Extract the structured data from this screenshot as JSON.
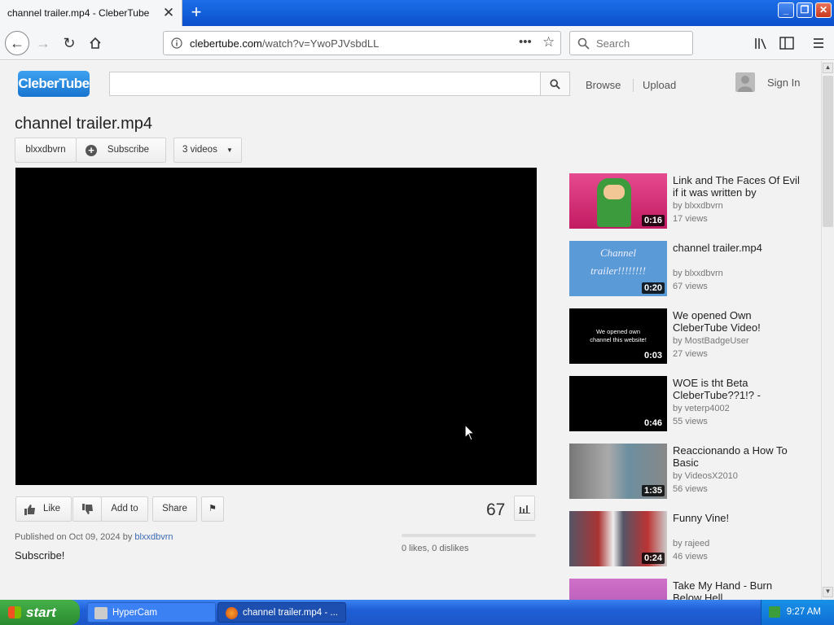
{
  "browser": {
    "tab_title": "channel trailer.mp4 - CleberTube",
    "url_domain": "clebertube.com",
    "url_path": "/watch?v=YwoPJVsbdLL",
    "search_placeholder": "Search"
  },
  "site": {
    "logo_text": "CleberTube",
    "nav_browse": "Browse",
    "nav_upload": "Upload",
    "sign_in": "Sign In"
  },
  "video": {
    "title": "channel trailer.mp4",
    "channel": "blxxdbvrn",
    "subscribe_label": "Subscribe",
    "videos_label": "3 videos",
    "like_label": "Like",
    "add_to_label": "Add to",
    "share_label": "Share",
    "view_count": "67",
    "likes_text": "0 likes, 0 dislikes",
    "published_prefix": "Published on Oct 09, 2024 by",
    "published_user": "blxxdbvrn",
    "description": "Subscribe!",
    "like_ratio": 0
  },
  "related": [
    {
      "title": "Link and The Faces Of Evil if it was written by",
      "by": "by blxxdbvrn",
      "views": "17 views",
      "duration": "0:16",
      "thumb": "link"
    },
    {
      "title": "channel trailer.mp4",
      "by": "by blxxdbvrn",
      "views": "67 views",
      "duration": "0:20",
      "thumb": "channel",
      "thumb_text": "Channel trailer!!!!!!!!"
    },
    {
      "title": "We opened Own CleberTube Video!",
      "by": "by MostBadgeUser",
      "views": "27 views",
      "duration": "0:03",
      "thumb": "opened",
      "thumb_text": "We opened own channel this website!"
    },
    {
      "title": "WOE is tht Beta CleberTube??1!? -",
      "by": "by veterp4002",
      "views": "55 views",
      "duration": "0:46",
      "thumb": "black"
    },
    {
      "title": "Reaccionando a How To Basic",
      "by": "by VideosX2010",
      "views": "56 views",
      "duration": "1:35",
      "thumb": "room"
    },
    {
      "title": "Funny Vine!",
      "by": "by rajeed",
      "views": "46 views",
      "duration": "0:24",
      "thumb": "vine"
    },
    {
      "title": "Take My Hand - Burn Below Hell",
      "by": "",
      "views": "",
      "duration": "",
      "thumb": "pink"
    }
  ],
  "taskbar": {
    "start_label": "start",
    "task1": "HyperCam",
    "task2": "channel trailer.mp4 - ...",
    "clock": "9:27 AM"
  },
  "colors": {
    "logo": "#1974cf",
    "taskbar": "#1f5fd6",
    "start": "#2a8a2e"
  }
}
